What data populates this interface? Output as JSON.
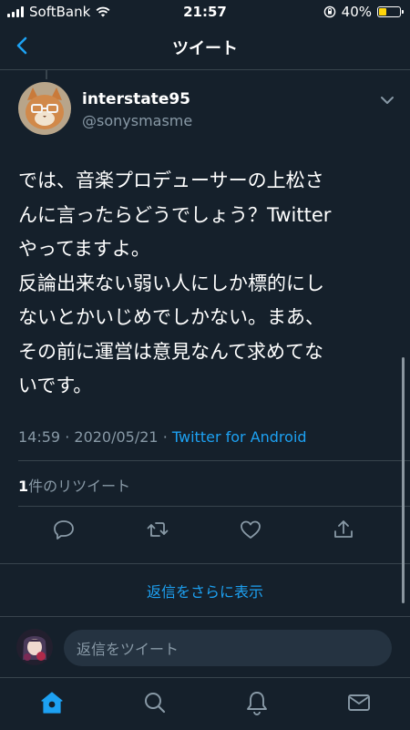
{
  "status_bar": {
    "carrier": "SoftBank",
    "time": "21:57",
    "battery": "40%",
    "battery_level": 0.4
  },
  "nav": {
    "title": "ツイート",
    "back_icon": "chevron-left-icon"
  },
  "tweet": {
    "author_name": "interstate95",
    "handle": "@sonysmasme",
    "text_lines": [
      "では、音楽プロデューサーの上松さ",
      "んに言ったらどうでしょう？Twitter",
      "やってますよ。",
      "反論出来ない弱い人にしか標的にし",
      "ないとかいじめでしかない。まあ、",
      "その前に運営は意見なんて求めてな",
      "いです。"
    ],
    "time": "14:59",
    "separator": "·",
    "date": "2020/05/21",
    "source": "Twitter for Android",
    "retweet_count": "1",
    "retweet_label": "件のリツイート"
  },
  "actions": [
    "reply-icon",
    "retweet-icon",
    "like-icon",
    "share-icon"
  ],
  "show_more_replies": "返信をさらに表示",
  "reply_bar": {
    "placeholder": "返信をツイート"
  },
  "tab_bar": [
    "home-icon",
    "search-icon",
    "notifications-icon",
    "messages-icon"
  ],
  "colors": {
    "background": "#15202b",
    "accent": "#1da1f2",
    "secondary_text": "#8899a6",
    "divider": "#38444d"
  }
}
